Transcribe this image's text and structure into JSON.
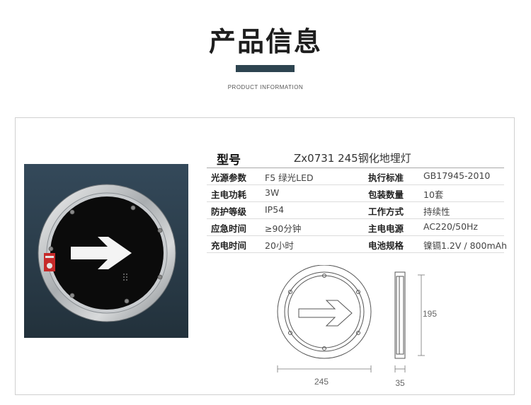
{
  "header": {
    "title": "产品信息",
    "subtitle": "PRODUCT INFORMATION"
  },
  "product": {
    "model_label": "型号",
    "model_value": "Zx0731 245钢化地埋灯",
    "specs": [
      {
        "k1": "光源参数",
        "v1": "F5 绿光LED",
        "k2": "执行标准",
        "v2": "GB17945-2010"
      },
      {
        "k1": "主电功耗",
        "v1": "3W",
        "k2": "包装数量",
        "v2": "10套"
      },
      {
        "k1": "防护等级",
        "v1": "IP54",
        "k2": "工作方式",
        "v2": "持续性"
      },
      {
        "k1": "应急时间",
        "v1": "≥90分钟",
        "k2": "主电电源",
        "v2": "AC220/50Hz"
      },
      {
        "k1": "充电时间",
        "v1": "20小时",
        "k2": "电池规格",
        "v2": "镍镉1.2V / 800mAh"
      }
    ]
  },
  "drawing": {
    "width_dim": "245",
    "height_dim": "195",
    "depth_dim": "35"
  },
  "colors": {
    "accent_bar": "#2d4450",
    "photo_bg": "#2c3d4a"
  }
}
